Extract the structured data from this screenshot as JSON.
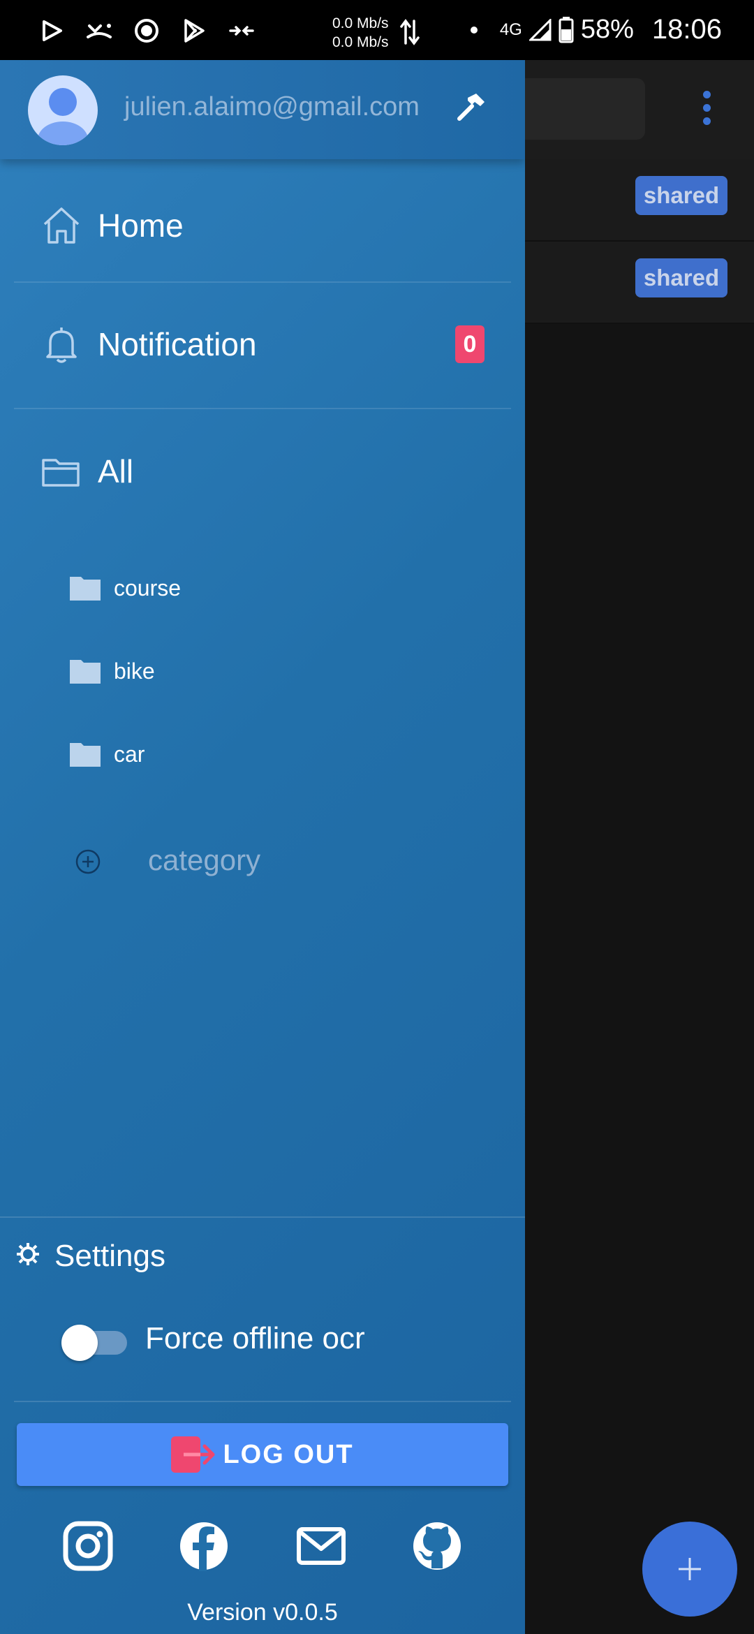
{
  "status_bar": {
    "net_up": "0.0 Mb/s",
    "net_down": "0.0 Mb/s",
    "network": "4G",
    "battery": "58%",
    "time": "18:06"
  },
  "drawer": {
    "email": "julien.alaimo@gmail.com",
    "nav": {
      "home": "Home",
      "notification": "Notification",
      "notification_count": "0",
      "all": "All"
    },
    "categories": [
      "course",
      "bike",
      "car"
    ],
    "add_category_placeholder": "category",
    "settings_label": "Settings",
    "force_offline_label": "Force offline ocr",
    "force_offline_enabled": false,
    "logout_label": "LOG OUT",
    "version": "Version v0.0.5"
  },
  "background": {
    "badges": [
      "shared",
      "shared"
    ]
  },
  "colors": {
    "drawer": "#2270aa",
    "accent": "#4a8cf7",
    "badge": "#ef476f",
    "shared_badge": "#3f6fcc"
  },
  "icons": [
    "play-icon",
    "missed-call-icon",
    "target-icon",
    "play-store-icon",
    "compress-icon",
    "data-arrows-icon",
    "signal-icon",
    "battery-icon",
    "avatar",
    "hammer-icon",
    "home-icon",
    "bell-icon",
    "folder-open-icon",
    "folder-icon",
    "add-circle-icon",
    "gear-icon",
    "logout-icon",
    "instagram-icon",
    "facebook-icon",
    "mail-icon",
    "github-icon",
    "more-vert-icon",
    "plus-icon"
  ]
}
